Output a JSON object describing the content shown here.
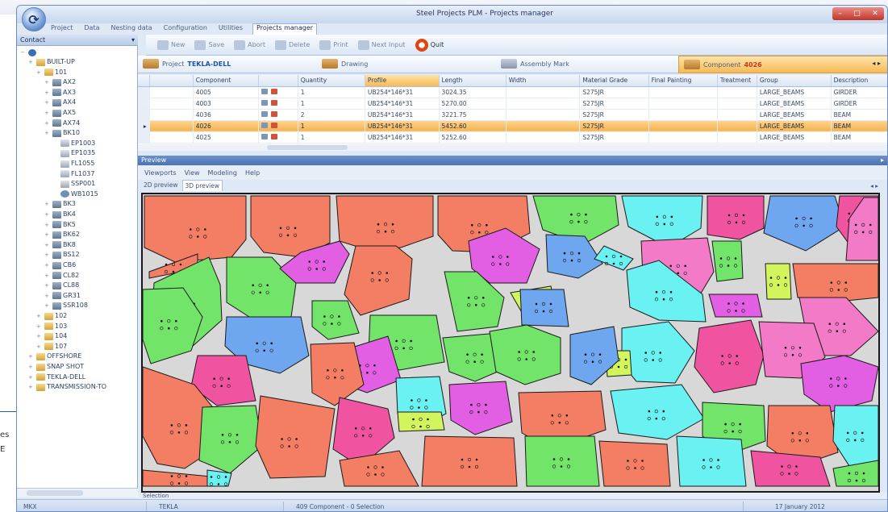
{
  "outer": {
    "fragments": [
      "es",
      "E"
    ]
  },
  "window": {
    "title": "Steel Projects PLM - Projects manager",
    "controls": [
      "–",
      "□",
      "✕"
    ]
  },
  "ribbon": {
    "tabs": [
      "Project",
      "Data",
      "Nesting data",
      "Configuration",
      "Utilities",
      "Projects manager"
    ]
  },
  "toolbar": {
    "new": "New",
    "save": "Save",
    "abort": "Abort",
    "delete": "Delete",
    "print": "Print",
    "next_input": "Next Input",
    "quit": "Quit"
  },
  "contact": {
    "title": "Contact",
    "pin": "▾"
  },
  "tree": {
    "root_icon": "tree-root-icon",
    "nodes": [
      {
        "label": "BUILT-UP",
        "indent": 1,
        "icon": "folder"
      },
      {
        "label": "101",
        "indent": 2,
        "icon": "folder"
      },
      {
        "label": "AX2",
        "indent": 3,
        "icon": "asm"
      },
      {
        "label": "AX3",
        "indent": 3,
        "icon": "asm"
      },
      {
        "label": "AX4",
        "indent": 3,
        "icon": "asm"
      },
      {
        "label": "AX5",
        "indent": 3,
        "icon": "asm"
      },
      {
        "label": "AX74",
        "indent": 3,
        "icon": "asm"
      },
      {
        "label": "BK10",
        "indent": 3,
        "icon": "asm"
      },
      {
        "label": "EP1003",
        "indent": 4,
        "icon": "part"
      },
      {
        "label": "EP1035",
        "indent": 4,
        "icon": "part"
      },
      {
        "label": "FL1055",
        "indent": 4,
        "icon": "part"
      },
      {
        "label": "FL1037",
        "indent": 4,
        "icon": "part"
      },
      {
        "label": "SSP001",
        "indent": 4,
        "icon": "part"
      },
      {
        "label": "WB1015",
        "indent": 4,
        "icon": "weld"
      },
      {
        "label": "BK3",
        "indent": 3,
        "icon": "asm"
      },
      {
        "label": "BK4",
        "indent": 3,
        "icon": "asm"
      },
      {
        "label": "BK5",
        "indent": 3,
        "icon": "asm"
      },
      {
        "label": "BK62",
        "indent": 3,
        "icon": "asm"
      },
      {
        "label": "BK8",
        "indent": 3,
        "icon": "asm"
      },
      {
        "label": "BS12",
        "indent": 3,
        "icon": "asm"
      },
      {
        "label": "CB6",
        "indent": 3,
        "icon": "asm"
      },
      {
        "label": "CL82",
        "indent": 3,
        "icon": "asm"
      },
      {
        "label": "CL88",
        "indent": 3,
        "icon": "asm"
      },
      {
        "label": "GR31",
        "indent": 3,
        "icon": "asm"
      },
      {
        "label": "SSR108",
        "indent": 3,
        "icon": "asm"
      },
      {
        "label": "102",
        "indent": 2,
        "icon": "folder"
      },
      {
        "label": "103",
        "indent": 2,
        "icon": "folder"
      },
      {
        "label": "104",
        "indent": 2,
        "icon": "folder"
      },
      {
        "label": "107",
        "indent": 2,
        "icon": "folder"
      },
      {
        "label": "OFFSHORE",
        "indent": 1,
        "icon": "folder"
      },
      {
        "label": "SNAP SHOT",
        "indent": 1,
        "icon": "folder"
      },
      {
        "label": "TEKLA-DELL",
        "indent": 1,
        "icon": "folder"
      },
      {
        "label": "TRANSMISSION-TO",
        "indent": 1,
        "icon": "folder"
      }
    ]
  },
  "project_bar": {
    "project_label": "Project",
    "project_name": "TEKLA-DELL",
    "drawing": "Drawing",
    "assembly_mark": "Assembly Mark",
    "component_label": "Component",
    "component_value": "4026",
    "nav": "◂ ▸"
  },
  "table": {
    "columns": [
      "",
      "",
      "Component",
      "",
      "Quantity",
      "Profile",
      "Length",
      "Width",
      "Material Grade",
      "Final Painting",
      "Treatment",
      "Group",
      "Description"
    ],
    "rows": [
      {
        "marker": "",
        "component": "4005",
        "quantity": "1",
        "profile": "UB254*146*31",
        "length": "3024.35",
        "width": "",
        "material": "S275JR",
        "painting": "",
        "treatment": "",
        "group": "LARGE_BEAMS",
        "description": "GIRDER",
        "selected": false
      },
      {
        "marker": "",
        "component": "4003",
        "quantity": "1",
        "profile": "UB254*146*31",
        "length": "5270.00",
        "width": "",
        "material": "S275JR",
        "painting": "",
        "treatment": "",
        "group": "LARGE_BEAMS",
        "description": "GIRDER",
        "selected": false
      },
      {
        "marker": "",
        "component": "4036",
        "quantity": "2",
        "profile": "UB254*146*31",
        "length": "3221.75",
        "width": "",
        "material": "S275JR",
        "painting": "",
        "treatment": "",
        "group": "LARGE_BEAMS",
        "description": "BEAM",
        "selected": false
      },
      {
        "marker": "▸",
        "component": "4026",
        "quantity": "1",
        "profile": "UB254*146*31",
        "length": "5452.60",
        "width": "",
        "material": "S275JR",
        "painting": "",
        "treatment": "",
        "group": "LARGE_BEAMS",
        "description": "BEAM",
        "selected": true
      },
      {
        "marker": "",
        "component": "4025",
        "quantity": "1",
        "profile": "UB254*146*31",
        "length": "5252.60",
        "width": "",
        "material": "S275JR",
        "painting": "",
        "treatment": "",
        "group": "LARGE_BEAMS",
        "description": "BEAM",
        "selected": false
      }
    ]
  },
  "preview": {
    "header": "Preview",
    "menu": [
      "Viewports",
      "View",
      "Modeling",
      "Help"
    ],
    "tabs": [
      "2D preview",
      "3D preview"
    ],
    "active_tab": "3D preview",
    "tab_nav": "◂ ▸",
    "colors": {
      "salmon": "#f47e64",
      "green": "#72e46a",
      "violet": "#e25fe3",
      "magenta": "#f054a0",
      "pink": "#f37ac7",
      "cyan": "#6af1f1",
      "blue": "#6fa6f0",
      "purple": "#9e6ef1",
      "lime": "#d2f45d",
      "sheet": "#d8d8d8"
    }
  },
  "selection_label": "Selection",
  "status": {
    "user": "MKX",
    "software": "TEKLA",
    "count": "409 Component - 0 Selection",
    "date": "17 January 2012"
  }
}
